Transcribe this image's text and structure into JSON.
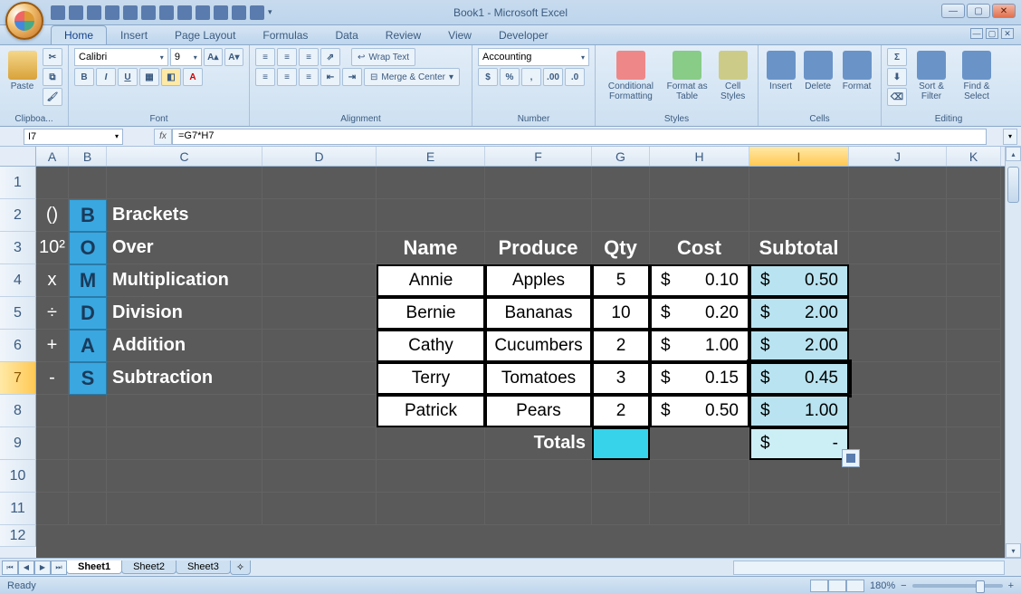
{
  "app": {
    "title": "Book1 - Microsoft Excel"
  },
  "tabs": {
    "home": "Home",
    "insert": "Insert",
    "pagelayout": "Page Layout",
    "formulas": "Formulas",
    "data": "Data",
    "review": "Review",
    "view": "View",
    "developer": "Developer"
  },
  "ribbon": {
    "clipboard": {
      "label": "Clipboa...",
      "paste": "Paste"
    },
    "font": {
      "label": "Font",
      "name": "Calibri",
      "size": "9",
      "bold": "B",
      "italic": "I",
      "underline": "U"
    },
    "alignment": {
      "label": "Alignment",
      "wrap": "Wrap Text",
      "merge": "Merge & Center"
    },
    "number": {
      "label": "Number",
      "format": "Accounting",
      "dollar": "$",
      "percent": "%",
      "comma": ","
    },
    "styles": {
      "label": "Styles",
      "cond": "Conditional Formatting",
      "table": "Format as Table",
      "cell": "Cell Styles"
    },
    "cells": {
      "label": "Cells",
      "insert": "Insert",
      "delete": "Delete",
      "format": "Format"
    },
    "editing": {
      "label": "Editing",
      "sort": "Sort & Filter",
      "find": "Find & Select"
    }
  },
  "namebox": "I7",
  "formula": "=G7*H7",
  "columns": [
    "A",
    "B",
    "C",
    "D",
    "E",
    "F",
    "G",
    "H",
    "I",
    "J",
    "K"
  ],
  "rows": [
    "1",
    "2",
    "3",
    "4",
    "5",
    "6",
    "7",
    "8",
    "9",
    "10",
    "11",
    "12"
  ],
  "bomdas": [
    {
      "op": "()",
      "letter": "B",
      "word": "Brackets"
    },
    {
      "op": "10²",
      "letter": "O",
      "word": "Over"
    },
    {
      "op": "x",
      "letter": "M",
      "word": "Multiplication"
    },
    {
      "op": "÷",
      "letter": "D",
      "word": "Division"
    },
    {
      "op": "+",
      "letter": "A",
      "word": "Addition"
    },
    {
      "op": "-",
      "letter": "S",
      "word": "Subtraction"
    }
  ],
  "table": {
    "headers": {
      "name": "Name",
      "produce": "Produce",
      "qty": "Qty",
      "cost": "Cost",
      "subtotal": "Subtotal"
    },
    "rows": [
      {
        "name": "Annie",
        "produce": "Apples",
        "qty": "5",
        "cost": "0.10",
        "sub": "0.50"
      },
      {
        "name": "Bernie",
        "produce": "Bananas",
        "qty": "10",
        "cost": "0.20",
        "sub": "2.00"
      },
      {
        "name": "Cathy",
        "produce": "Cucumbers",
        "qty": "2",
        "cost": "1.00",
        "sub": "2.00"
      },
      {
        "name": "Terry",
        "produce": "Tomatoes",
        "qty": "3",
        "cost": "0.15",
        "sub": "0.45"
      },
      {
        "name": "Patrick",
        "produce": "Pears",
        "qty": "2",
        "cost": "0.50",
        "sub": "1.00"
      }
    ],
    "totals_label": "Totals",
    "totals_sub": "-",
    "dollar": "$"
  },
  "sheets": {
    "s1": "Sheet1",
    "s2": "Sheet2",
    "s3": "Sheet3"
  },
  "status": {
    "ready": "Ready",
    "zoom": "180%"
  }
}
